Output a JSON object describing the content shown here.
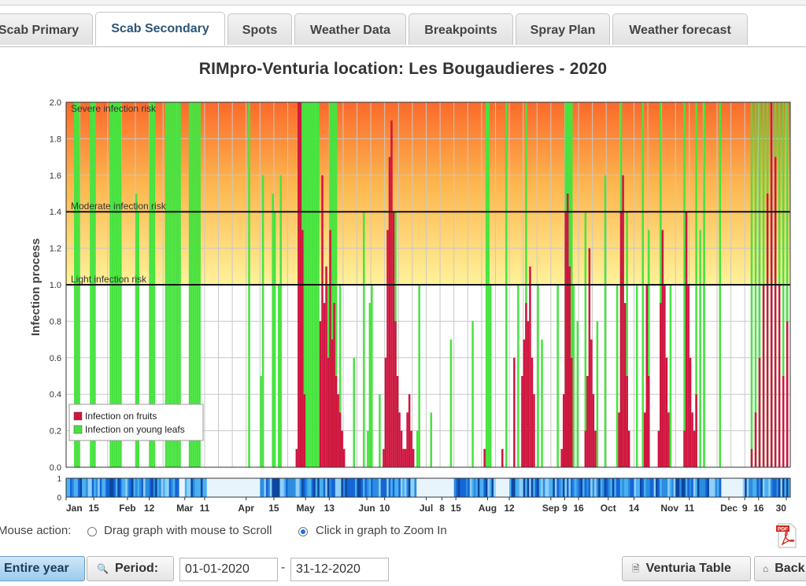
{
  "tabs": [
    {
      "label": "Scab Primary",
      "active": false
    },
    {
      "label": "Scab Secondary",
      "active": true
    },
    {
      "label": "Spots",
      "active": false
    },
    {
      "label": "Weather Data",
      "active": false
    },
    {
      "label": "Breakpoints",
      "active": false
    },
    {
      "label": "Spray Plan",
      "active": false
    },
    {
      "label": "Weather forecast",
      "active": false
    }
  ],
  "title": "RIMpro-Venturia location:  Les Bougaudieres - 2020",
  "chart_data": {
    "type": "bar",
    "ylabel": "Infection process",
    "ylim": [
      0,
      2.0
    ],
    "yticks": [
      "0.0",
      "0.2",
      "0.4",
      "0.6",
      "0.8",
      "1.0",
      "1.2",
      "1.4",
      "1.6",
      "1.8",
      "2.0"
    ],
    "risk_levels": [
      {
        "label": "Severe infection risk",
        "value": 2.0
      },
      {
        "label": "Moderate infection risk",
        "value": 1.4
      },
      {
        "label": "Light infection risk",
        "value": 1.0
      }
    ],
    "xticks": [
      "Jan",
      "15",
      "Feb",
      "12",
      "Mar",
      "11",
      "Apr",
      "15",
      "May",
      "13",
      "Jun",
      "10",
      "Jul",
      "8",
      "15",
      "Aug",
      "12",
      "Sep",
      "9",
      "16",
      "Oct",
      "14",
      "Nov",
      "11",
      "Dec",
      "9",
      "16",
      "30"
    ],
    "legend": [
      {
        "name": "Infection on fruits",
        "color": "#d0143f"
      },
      {
        "name": "Infection on young leafs",
        "color": "#47e33f"
      }
    ],
    "series": [
      {
        "name": "Infection on young leafs",
        "color": "#47e33f",
        "days": [
          4,
          5,
          6,
          12,
          13,
          14,
          22,
          23,
          24,
          25,
          26,
          27,
          35,
          36,
          42,
          43,
          44,
          50,
          51,
          52,
          53,
          54,
          55,
          56,
          57,
          62,
          63,
          64,
          65,
          66,
          67,
          92,
          98,
          99,
          104,
          105,
          107,
          108,
          118,
          119,
          120,
          121,
          122,
          123,
          124,
          125,
          126,
          127,
          132,
          133,
          134,
          135,
          136,
          138,
          145,
          150,
          152,
          153,
          154,
          158,
          166,
          177,
          178,
          184,
          194,
          205,
          212,
          213,
          214,
          222,
          228,
          232,
          238,
          240,
          248,
          252,
          253,
          254,
          255,
          256,
          258,
          262,
          268,
          272,
          278,
          280,
          283,
          288,
          291,
          294,
          300,
          305,
          312,
          318,
          320,
          322,
          330,
          346,
          348,
          350,
          352,
          354,
          356,
          358,
          360,
          362,
          364
        ],
        "values": [
          2.0,
          2.0,
          2.0,
          2.0,
          2.0,
          2.0,
          2.0,
          2.0,
          2.0,
          2.0,
          2.0,
          2.0,
          1.5,
          1.4,
          2.0,
          2.0,
          2.0,
          2.0,
          2.0,
          2.0,
          2.0,
          2.0,
          2.0,
          2.0,
          2.0,
          2.0,
          2.0,
          2.0,
          2.0,
          2.0,
          2.0,
          2.0,
          0.5,
          1.6,
          1.5,
          1.4,
          1.0,
          1.6,
          2.0,
          2.0,
          2.0,
          2.0,
          2.0,
          2.0,
          2.0,
          2.0,
          2.0,
          2.0,
          1.0,
          2.0,
          2.0,
          2.0,
          2.0,
          1.0,
          0.6,
          1.4,
          0.2,
          0.9,
          1.0,
          0.4,
          1.4,
          0.2,
          1.0,
          0.3,
          0.7,
          0.8,
          2.0,
          2.0,
          1.0,
          2.0,
          1.0,
          2.0,
          1.0,
          0.7,
          1.0,
          2.0,
          2.0,
          2.0,
          2.0,
          1.0,
          0.8,
          1.4,
          0.8,
          1.6,
          1.0,
          2.0,
          1.4,
          1.0,
          2.0,
          1.3,
          2.0,
          1.0,
          2.0,
          2.0,
          1.3,
          2.0,
          2.0,
          2.0,
          2.0,
          2.0,
          2.0,
          2.0,
          2.0,
          2.0,
          2.0,
          2.0,
          2.0
        ]
      },
      {
        "name": "Infection on fruits",
        "color": "#d0143f",
        "days": [
          116,
          117,
          118,
          119,
          120,
          128,
          129,
          130,
          131,
          132,
          133,
          134,
          135,
          136,
          137,
          138,
          139,
          140,
          160,
          161,
          162,
          163,
          164,
          165,
          166,
          167,
          168,
          169,
          170,
          171,
          172,
          173,
          174,
          175,
          211,
          220,
          226,
          230,
          231,
          232,
          233,
          234,
          235,
          236,
          250,
          251,
          252,
          253,
          254,
          255,
          262,
          263,
          264,
          265,
          266,
          267,
          279,
          280,
          281,
          282,
          283,
          284,
          292,
          293,
          294,
          299,
          300,
          301,
          302,
          303,
          304,
          312,
          313,
          314,
          315,
          316,
          317,
          318,
          346,
          348,
          350,
          352,
          354,
          356,
          358,
          360,
          362,
          364
        ],
        "values": [
          0.1,
          2.0,
          2.0,
          1.3,
          0.4,
          0.8,
          1.6,
          0.9,
          1.1,
          0.6,
          1.3,
          0.7,
          0.9,
          0.5,
          0.4,
          0.3,
          0.2,
          0.1,
          0.1,
          0.6,
          1.3,
          1.7,
          1.9,
          1.4,
          0.8,
          0.5,
          0.3,
          0.2,
          0.1,
          0.1,
          0.3,
          0.4,
          0.2,
          0.1,
          0.1,
          0.1,
          0.6,
          0.5,
          0.7,
          0.9,
          0.8,
          1.1,
          0.6,
          0.4,
          0.1,
          0.4,
          1.4,
          1.5,
          1.1,
          0.6,
          0.2,
          0.5,
          1.2,
          0.7,
          0.4,
          0.2,
          0.3,
          1.4,
          1.6,
          0.9,
          0.5,
          0.2,
          0.3,
          1.0,
          0.5,
          0.2,
          0.9,
          1.3,
          1.0,
          0.6,
          0.3,
          0.2,
          1.4,
          1.0,
          0.6,
          0.3,
          0.2,
          0.4,
          0.1,
          0.3,
          0.6,
          1.0,
          1.5,
          2.0,
          1.7,
          1.0,
          0.5,
          0.8
        ]
      }
    ],
    "weather_strip": {
      "ylim": [
        0,
        1
      ],
      "yticks": [
        "1",
        "0"
      ]
    }
  },
  "controls": {
    "mouse_action_label": "Mouse action:",
    "option_scroll": "Drag graph with mouse to Scroll",
    "option_zoom": "Click in graph to Zoom In",
    "entire_year": "Entire year",
    "period": "Period:",
    "date_from": "01-01-2020",
    "date_sep": "-",
    "date_to": "31-12-2020",
    "venturia_table": "Venturia Table",
    "back": "Back",
    "pdf_label": "PDF"
  }
}
